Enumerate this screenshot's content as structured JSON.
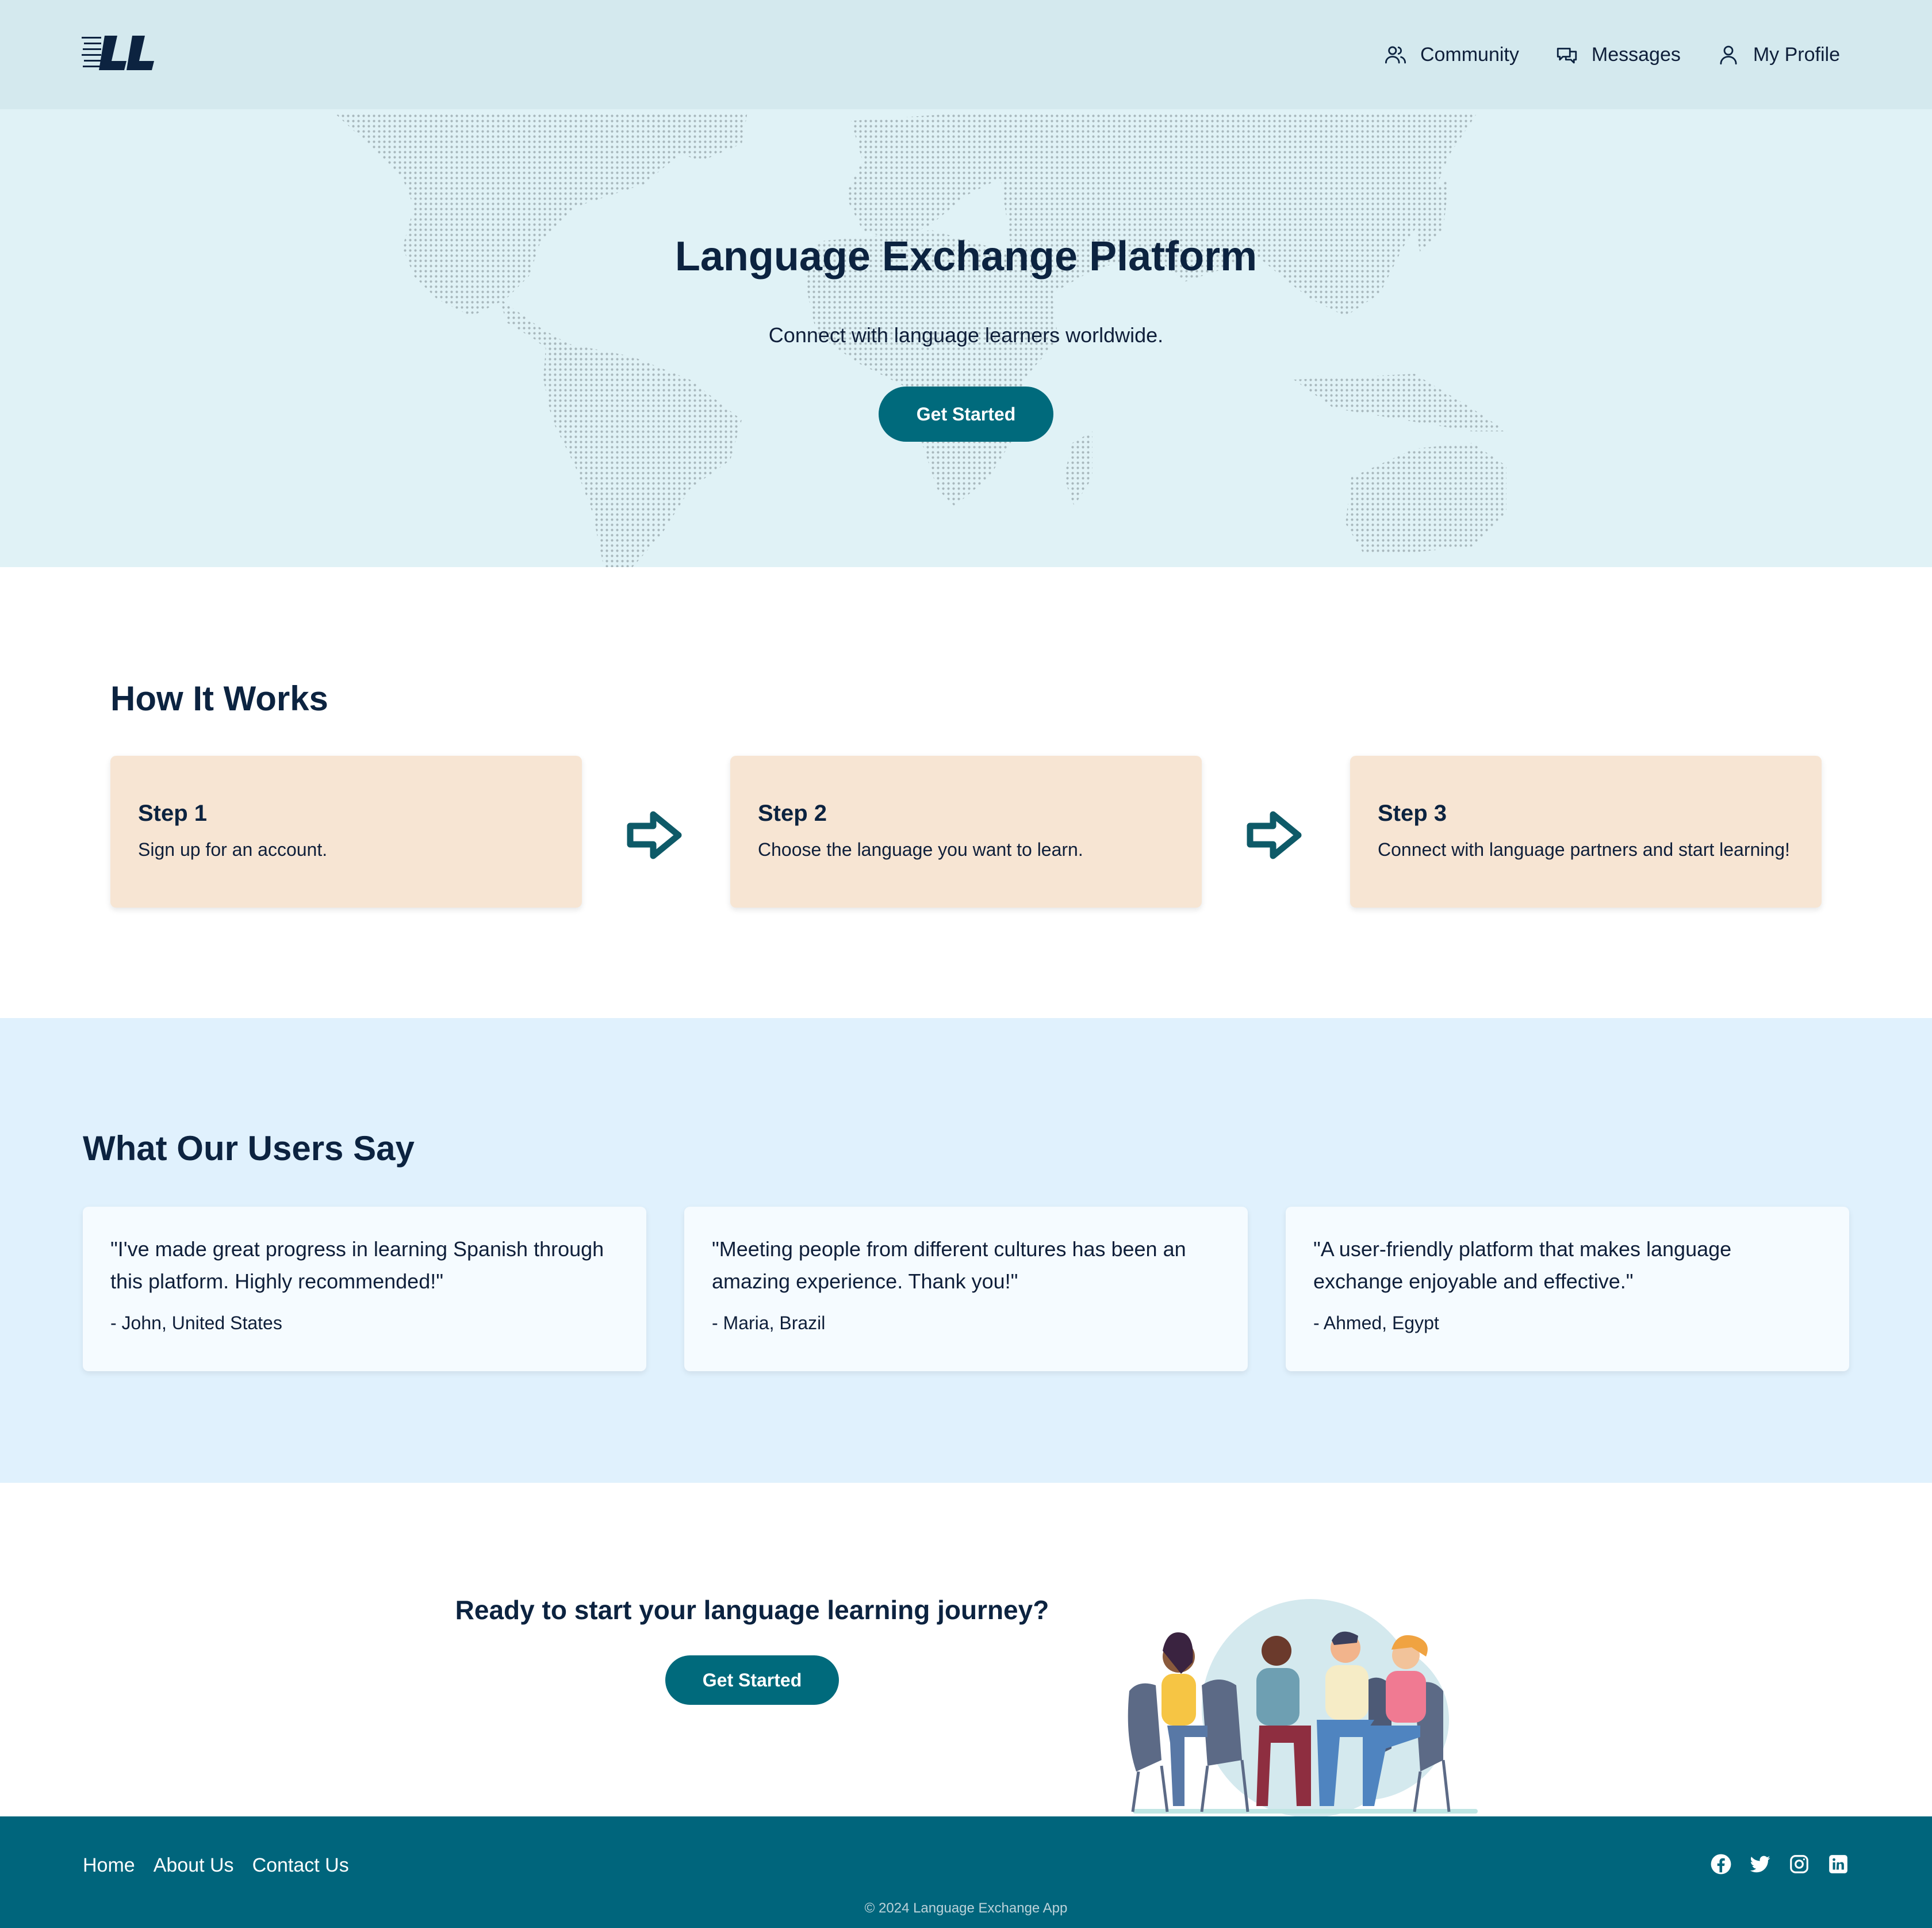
{
  "header": {
    "logo_text": "LL",
    "nav": [
      {
        "label": "Community",
        "icon": "users-icon"
      },
      {
        "label": "Messages",
        "icon": "chat-bubbles-icon"
      },
      {
        "label": "My Profile",
        "icon": "user-icon"
      }
    ]
  },
  "hero": {
    "title": "Language Exchange Platform",
    "subtitle": "Connect with language learners worldwide.",
    "cta_label": "Get Started"
  },
  "how_it_works": {
    "title": "How It Works",
    "steps": [
      {
        "title": "Step 1",
        "text": "Sign up for an account."
      },
      {
        "title": "Step 2",
        "text": "Choose the language you want to learn."
      },
      {
        "title": "Step 3",
        "text": "Connect with language partners and start learning!"
      }
    ]
  },
  "testimonials": {
    "title": "What Our Users Say",
    "items": [
      {
        "quote": "\"I've made great progress in learning Spanish through this platform. Highly recommended!\"",
        "author": "- John, United States"
      },
      {
        "quote": "\"Meeting people from different cultures has been an amazing experience. Thank you!\"",
        "author": "- Maria, Brazil"
      },
      {
        "quote": "\"A user-friendly platform that makes language exchange enjoyable and effective.\"",
        "author": "- Ahmed, Egypt"
      }
    ]
  },
  "cta": {
    "title": "Ready to start your language learning journey?",
    "button_label": "Get Started"
  },
  "footer": {
    "links": [
      "Home",
      "About Us",
      "Contact Us"
    ],
    "socials": [
      "facebook-icon",
      "twitter-icon",
      "instagram-icon",
      "linkedin-icon"
    ],
    "copyright": "© 2024 Language Exchange App"
  },
  "colors": {
    "header_bg": "#d4e9ee",
    "hero_bg": "#e0f2f6",
    "primary": "#006a7c",
    "step_card_bg": "#f7e5d3",
    "testimonials_bg": "#e0f1fd",
    "footer_bg": "#00657c",
    "heading": "#0c2340"
  }
}
